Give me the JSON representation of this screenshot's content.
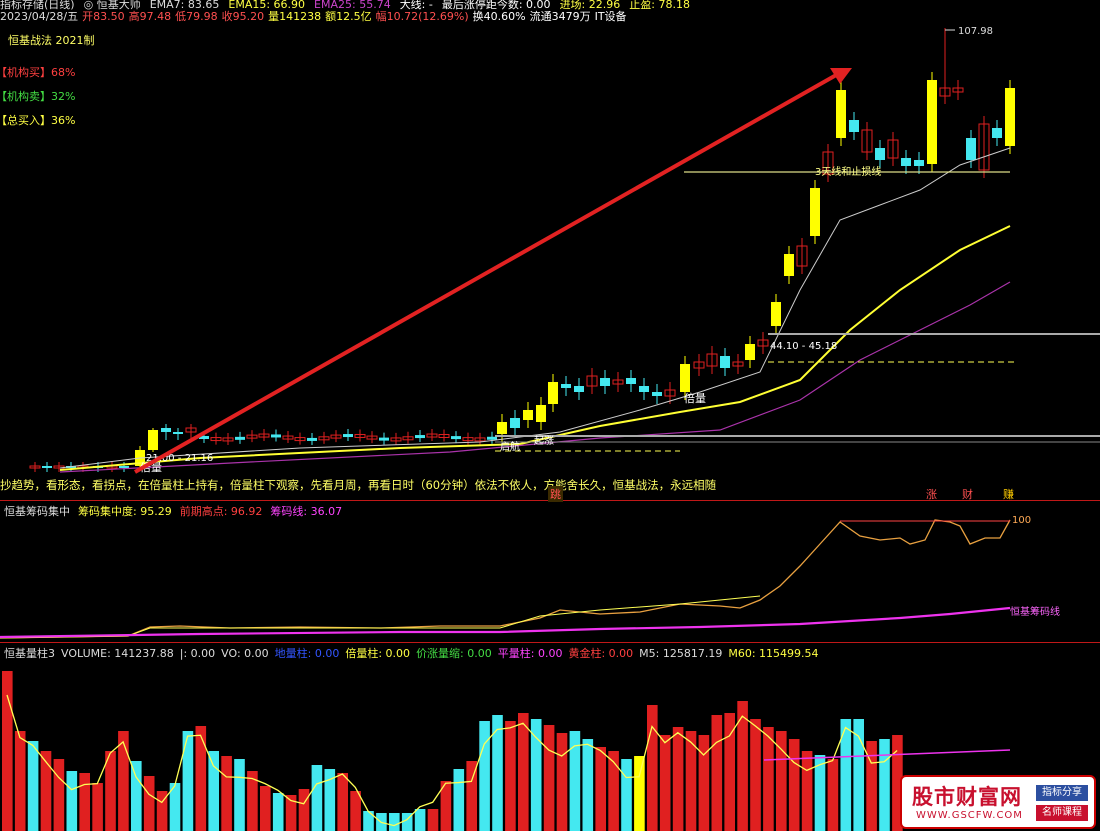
{
  "header": {
    "row1": [
      {
        "text": "指标存储(日线)",
        "color": "#dcdcdc"
      },
      {
        "text": "◎ 恒基大师",
        "color": "#dcdcdc"
      },
      {
        "text": "EMA7: 83.65",
        "color": "#dcdcdc"
      },
      {
        "text": "EMA15: 66.90",
        "color": "#ffff44"
      },
      {
        "text": "EMA25: 55.74",
        "color": "#cc44cc"
      },
      {
        "text": "大线: -",
        "color": "#ffffff"
      },
      {
        "text": "最后涨停距今数: 0.00",
        "color": "#ffffff"
      },
      {
        "text": "进场: 22.96",
        "color": "#ffff44"
      },
      {
        "text": "止盈: 78.18",
        "color": "#ffff44"
      }
    ],
    "row2": [
      {
        "text": "2023/04/28/五",
        "color": "#dcdcdc"
      },
      {
        "text": "开83.50",
        "color": "#ff5050"
      },
      {
        "text": "高97.48",
        "color": "#ff5050"
      },
      {
        "text": "低79.98",
        "color": "#ff5050"
      },
      {
        "text": "收95.20",
        "color": "#ff5050"
      },
      {
        "text": "量141238",
        "color": "#ffff44"
      },
      {
        "text": "额12.5亿",
        "color": "#ffff44"
      },
      {
        "text": "幅10.72(12.69%)",
        "color": "#ff5050"
      },
      {
        "text": "换40.60%",
        "color": "#ffffff"
      },
      {
        "text": "流通3479万",
        "color": "#ffffff"
      },
      {
        "text": "IT设备",
        "color": "#ffffff"
      }
    ],
    "title_label": "恒基战法 2021制",
    "legend": [
      {
        "text": "【机构买】68%",
        "color": "#ff4040"
      },
      {
        "text": "【机构卖】32%",
        "color": "#44dd44"
      },
      {
        "text": "【总买入】36%",
        "color": "#ffff44"
      }
    ]
  },
  "main_chart": {
    "high_label": "107.98",
    "support_label": "3天线和止损线",
    "range_label_1": "44.10 - 45.18",
    "range_label_2": "21.00 - 21.16",
    "signal_label_1": "倍量",
    "signal_label_2": "倍量",
    "bottom_marker_1": "起涨",
    "bottom_marker_2": "启航",
    "motto": "抄趋势，看形态，看拐点，在倍量柱上持有，倍量柱下观察，先看月周，再看日时（60分钟）依法不依人，方能舍长久，恒基战法，永远相随",
    "tags": [
      {
        "text": "涨",
        "color": "#ff5050"
      },
      {
        "text": "财",
        "color": "#ff5050"
      },
      {
        "text": "赚",
        "color": "#ffcc00"
      },
      {
        "text": "跳",
        "color": "#ff5050"
      }
    ]
  },
  "chip_panel": {
    "header": [
      {
        "text": "恒基筹码集中",
        "color": "#dcdcdc"
      },
      {
        "text": "筹码集中度: 95.29",
        "color": "#ffff44"
      },
      {
        "text": "前期高点: 96.92",
        "color": "#ff4040"
      },
      {
        "text": "筹码线: 36.07",
        "color": "#ff44ff"
      }
    ],
    "right_label_top": "100",
    "right_label_line": "恒基筹码线"
  },
  "volume_panel": {
    "header": [
      {
        "text": "恒基量柱3",
        "color": "#dcdcdc"
      },
      {
        "text": "VOLUME: 141237.88",
        "color": "#dcdcdc"
      },
      {
        "text": "|: 0.00",
        "color": "#dcdcdc"
      },
      {
        "text": "VO: 0.00",
        "color": "#dcdcdc"
      },
      {
        "text": "地量柱: 0.00",
        "color": "#3355ff"
      },
      {
        "text": "倍量柱: 0.00",
        "color": "#ffff44"
      },
      {
        "text": "价涨量缩: 0.00",
        "color": "#44dd44"
      },
      {
        "text": "平量柱: 0.00",
        "color": "#ff44ff"
      },
      {
        "text": "黄金柱: 0.00",
        "color": "#ff4040"
      },
      {
        "text": "M5: 125817.19",
        "color": "#dcdcdc"
      },
      {
        "text": "M60: 115499.54",
        "color": "#ffff44"
      }
    ]
  },
  "watermark": {
    "title": "股市财富网",
    "url": "WWW.GSCFW.COM",
    "tag1": "指标分享",
    "tag2": "名师课程"
  },
  "colors": {
    "up": "#e02020",
    "down": "#44e8f0",
    "yellow": "#ffff00",
    "arrow": "#e22222"
  }
}
